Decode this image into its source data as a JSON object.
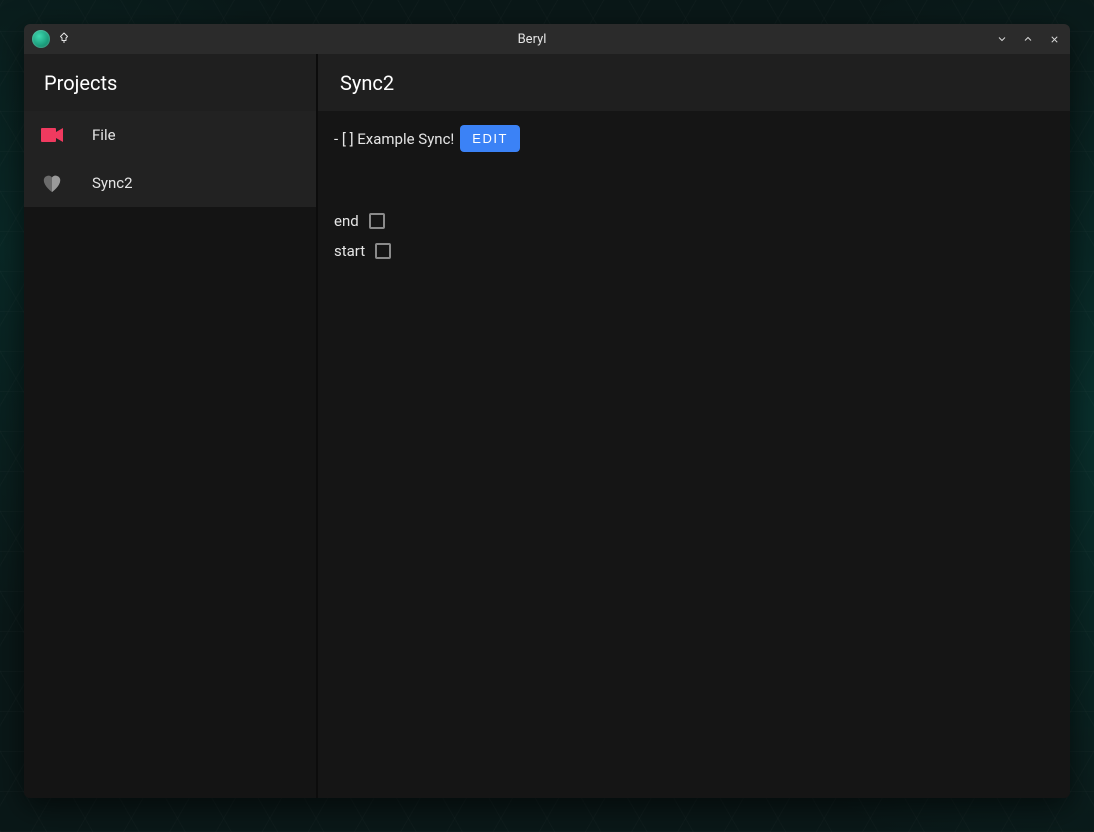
{
  "window": {
    "title": "Beryl"
  },
  "sidebar": {
    "header": "Projects",
    "items": [
      {
        "label": "File",
        "icon": "camera-icon"
      },
      {
        "label": "Sync2",
        "icon": "heart-icon"
      }
    ]
  },
  "main": {
    "title": "Sync2",
    "task_line": "- [ ] Example Sync!",
    "edit_label": "EDIT",
    "checkboxes": [
      {
        "label": "end",
        "checked": false
      },
      {
        "label": "start",
        "checked": false
      }
    ]
  },
  "colors": {
    "accent": "#3b82f6",
    "camera_icon": "#f03a5f",
    "heart_icon": "#8c8c8c"
  }
}
